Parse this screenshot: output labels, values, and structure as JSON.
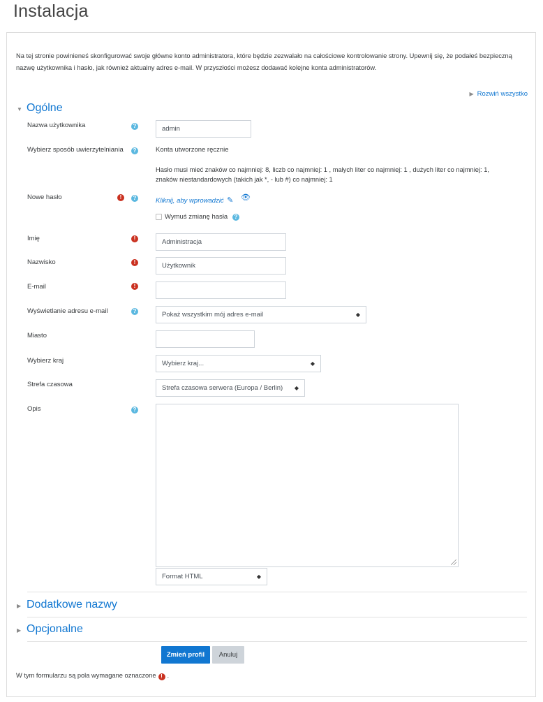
{
  "page": {
    "title": "Instalacja"
  },
  "intro": "Na tej stronie powinieneś skonfigurować swoje główne konto administratora, które będzie zezwalało na całościowe kontrolowanie strony. Upewnij się, że podałeś bezpieczną nazwę użytkownika i hasło, jak również aktualny adres e-mail. W przyszłości możesz dodawać kolejne konta administratorów.",
  "expand_all": "Rozwiń wszystko",
  "sections": {
    "general": "Ogólne",
    "additional_names": "Dodatkowe nazwy",
    "optional": "Opcjonalne"
  },
  "fields": {
    "username": {
      "label": "Nazwa użytkownika",
      "value": "admin"
    },
    "auth": {
      "label": "Wybierz sposób uwierzytelniania",
      "value": "Konta utworzone ręcznie",
      "hint_line1": "Hasło musi mieć znaków co najmniej: 8, liczb co najmniej: 1 , małych liter co najmniej: 1 , dużych liter co najmniej: 1,",
      "hint_line2": "znaków niestandardowych (takich jak *, - lub #) co najmniej: 1"
    },
    "new_password": {
      "label": "Nowe hasło",
      "link": "Kliknij, aby wprowadzić",
      "force_change_label": "Wymuś zmianę hasła",
      "force_change_checked": false
    },
    "firstname": {
      "label": "Imię",
      "value": "Administracja"
    },
    "lastname": {
      "label": "Nazwisko",
      "value": "Użytkownik"
    },
    "email": {
      "label": "E-mail",
      "value": ""
    },
    "email_display": {
      "label": "Wyświetlanie adresu e-mail",
      "selected": "Pokaż wszystkim mój adres e-mail"
    },
    "city": {
      "label": "Miasto",
      "value": ""
    },
    "country": {
      "label": "Wybierz kraj",
      "selected": "Wybierz kraj..."
    },
    "timezone": {
      "label": "Strefa czasowa",
      "selected": "Strefa czasowa serwera (Europa / Berlin)"
    },
    "description": {
      "label": "Opis",
      "value": "",
      "format_selected": "Format HTML"
    }
  },
  "buttons": {
    "submit": "Zmień profil",
    "cancel": "Anuluj"
  },
  "footer": {
    "required_note_before": "W tym formularzu są pola wymagane oznaczone",
    "required_note_after": "."
  },
  "icons": {
    "required": "exclamation-circle",
    "help": "question-circle",
    "pencil": "pencil",
    "eye": "eye",
    "caret": "up-down-caret"
  },
  "colors": {
    "link": "#1177d1",
    "required": "#ca3120",
    "help": "#5bb8e0",
    "primary_button": "#1177d1",
    "secondary_button": "#ced4da"
  }
}
